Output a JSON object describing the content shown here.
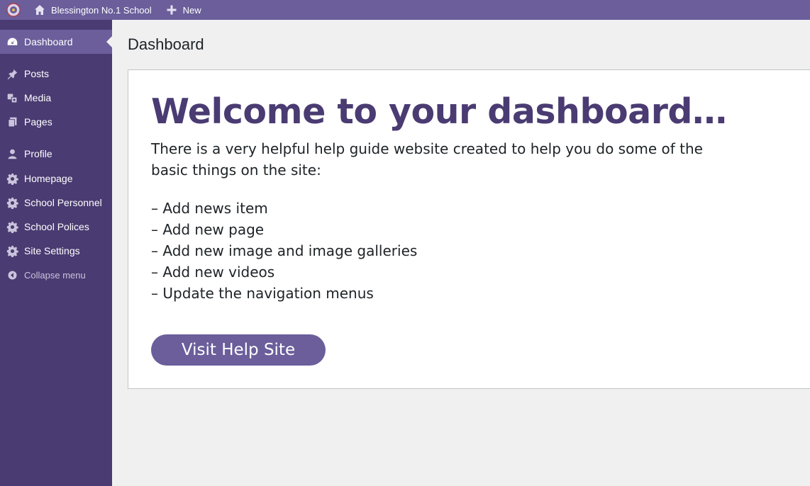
{
  "admin_bar": {
    "logo_icon": "school-crest-icon",
    "site_name": "Blessington No.1 School",
    "new_label": "New"
  },
  "sidebar": {
    "items": [
      {
        "label": "Dashboard",
        "icon": "dashboard-icon",
        "current": true
      },
      {
        "label": "Posts",
        "icon": "pin-icon"
      },
      {
        "label": "Media",
        "icon": "media-icon"
      },
      {
        "label": "Pages",
        "icon": "pages-icon"
      },
      {
        "label": "Profile",
        "icon": "user-icon"
      },
      {
        "label": "Homepage",
        "icon": "gear-icon"
      },
      {
        "label": "School Personnel",
        "icon": "gear-icon"
      },
      {
        "label": "School Polices",
        "icon": "gear-icon"
      },
      {
        "label": "Site Settings",
        "icon": "gear-icon"
      }
    ],
    "collapse_label": "Collapse menu"
  },
  "main": {
    "page_title": "Dashboard",
    "welcome": {
      "heading": "Welcome to your dashboard…",
      "intro": "There is a very helpful help guide website created to help you do some of the basic things on the site:",
      "tasks": [
        "– Add news item",
        "– Add new page",
        "– Add new image and image galleries",
        "– Add new videos",
        "– Update the navigation menus"
      ],
      "button_label": "Visit Help Site"
    }
  },
  "colors": {
    "admin_bar": "#6b5e9b",
    "sidebar": "#4a3b72",
    "heading": "#4a3b72",
    "button": "#6b5e9b"
  }
}
